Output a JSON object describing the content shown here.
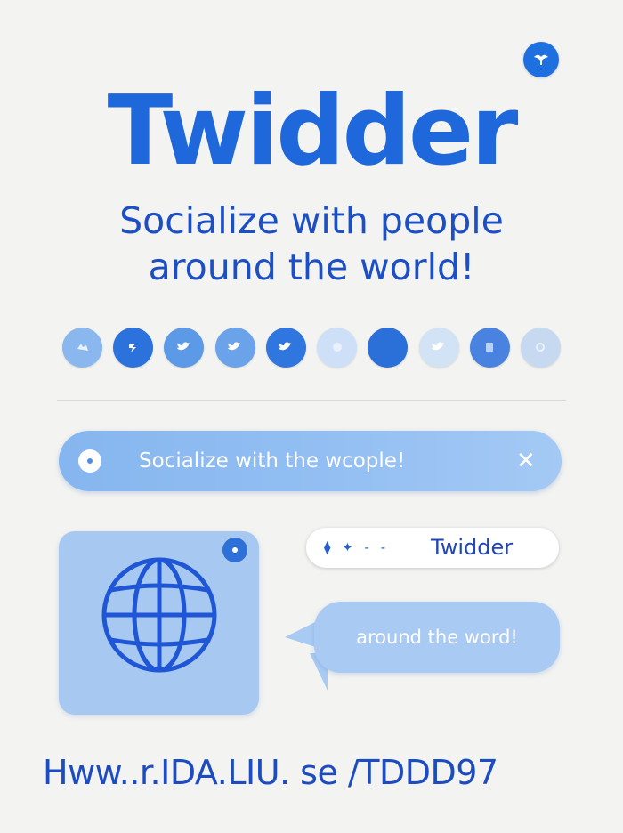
{
  "brand": {
    "title": "Twidder"
  },
  "tagline": {
    "line1": "Socialize with people",
    "line2": "around the world!"
  },
  "social_icons": [
    {
      "name": "icon-1",
      "color": "#8ab8ee"
    },
    {
      "name": "icon-2",
      "color": "#2b72dc"
    },
    {
      "name": "icon-3",
      "color": "#5c9ae8"
    },
    {
      "name": "icon-4",
      "color": "#6aa3ea"
    },
    {
      "name": "icon-5",
      "color": "#2f76de"
    },
    {
      "name": "icon-6",
      "color": "#cde0f7"
    },
    {
      "name": "icon-7",
      "color": "#2b6fd8"
    },
    {
      "name": "icon-8",
      "color": "#d2e3f6"
    },
    {
      "name": "icon-9",
      "color": "#4a83df"
    },
    {
      "name": "icon-10",
      "color": "#c7d9f1"
    }
  ],
  "search": {
    "text": "Socialize with the wcople!",
    "close": "✕"
  },
  "pill": {
    "icons": "⧫ ✦ - -",
    "label": "Twidder"
  },
  "bubble": {
    "text": "around the word!"
  },
  "footer": {
    "url": "Hww..r.IDA.LIU. se /TDDD97"
  },
  "colors": {
    "accent": "#1f68dc",
    "dark_blue": "#1d4fc4",
    "light_blue": "#a6c8f1"
  }
}
